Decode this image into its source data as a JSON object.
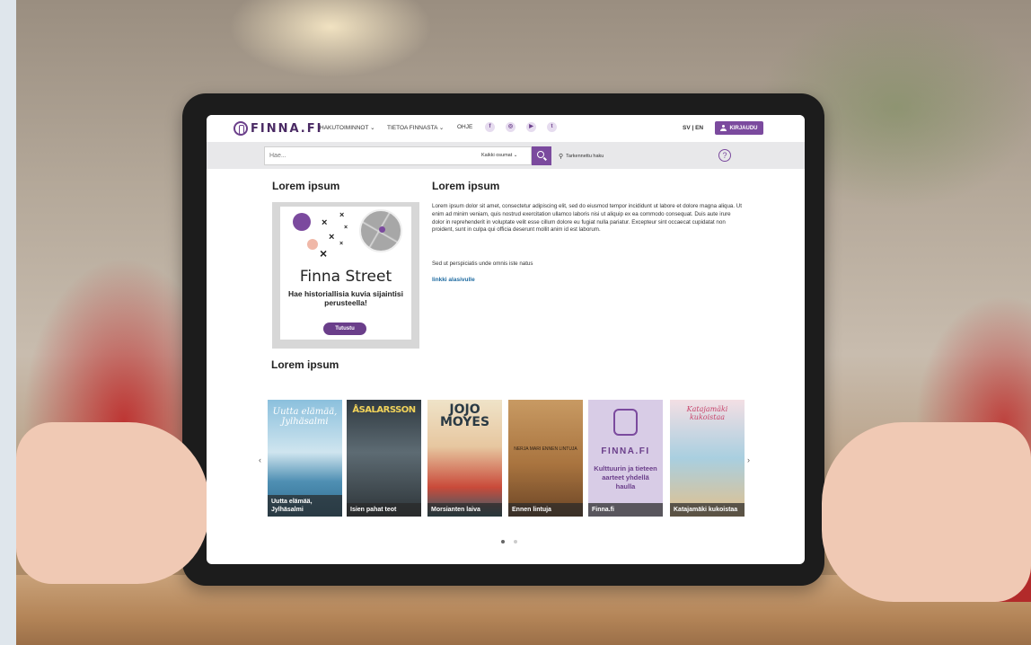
{
  "brand": {
    "logo_text": "FINNA.FI",
    "accent": "#7b4a9e"
  },
  "nav": {
    "items": [
      {
        "label": "HAKUTOIMINNOT ⌄"
      },
      {
        "label": "TIETOA FINNASTA ⌄"
      },
      {
        "label": "OHJE"
      }
    ],
    "social": [
      "f",
      "◎",
      "▶",
      "t"
    ],
    "lang": "SV | EN",
    "login_label": "KIRJAUDU"
  },
  "search": {
    "placeholder": "Hae...",
    "scope": "Kaikki osumat ⌄",
    "advanced_label": "Tarkennettu haku",
    "help": "?"
  },
  "main": {
    "left_heading": "Lorem ipsum",
    "right_heading": "Lorem ipsum",
    "paragraph": "Lorem ipsum dolor sit amet, consectetur adipiscing elit, sed do eiusmod tempor incididunt ut labore et dolore magna aliqua. Ut enim ad minim veniam, quis nostrud exercitation ullamco laboris nisi ut aliquip ex ea commodo consequat. Duis aute irure dolor in reprehenderit in voluptate velit esse cillum dolore eu fugiat nulla pariatur. Excepteur sint occaecat cupidatat non proident, sunt in culpa qui officia deserunt mollit anim id est laborum.",
    "paragraph2": "Sed ut perspiciatis unde omnis iste natus",
    "link": "linkki alasivulle",
    "bottom_heading": "Lorem ipsum"
  },
  "promo": {
    "title": "Finna Street",
    "subtitle": "Hae historiallisia kuvia sijaintisi perusteella!",
    "button": "Tutustu"
  },
  "carousel": {
    "prev": "‹",
    "next": "›",
    "books": [
      {
        "caption": "Uutta elämää, Jylhäsalmi",
        "cover_text": "Uutta elämää, Jylhäsalmi",
        "color": "#6fa8c8"
      },
      {
        "caption": "Isien pahat teot",
        "cover_text": "ÅSALARSSON",
        "color": "#3e4a52"
      },
      {
        "caption": "Morsianten laiva",
        "cover_text": "JOJO MOYES",
        "color": "#d9c9a8"
      },
      {
        "caption": "Ennen lintuja",
        "cover_text": "NERJA MARI ENNEN LINTUJA",
        "color": "#b88a55"
      },
      {
        "caption": "Finna.fi",
        "cover_text": "FINNA.FI",
        "cover_sub": "Kulttuurin ja tieteen aarteet yhdellä haulla",
        "color": "#d8cce6"
      },
      {
        "caption": "Katajamäki kukoistaa",
        "cover_text": "Katajamäki kukoistaa",
        "color": "#9cc4d6"
      }
    ],
    "pages": 2,
    "active_page": 1
  }
}
